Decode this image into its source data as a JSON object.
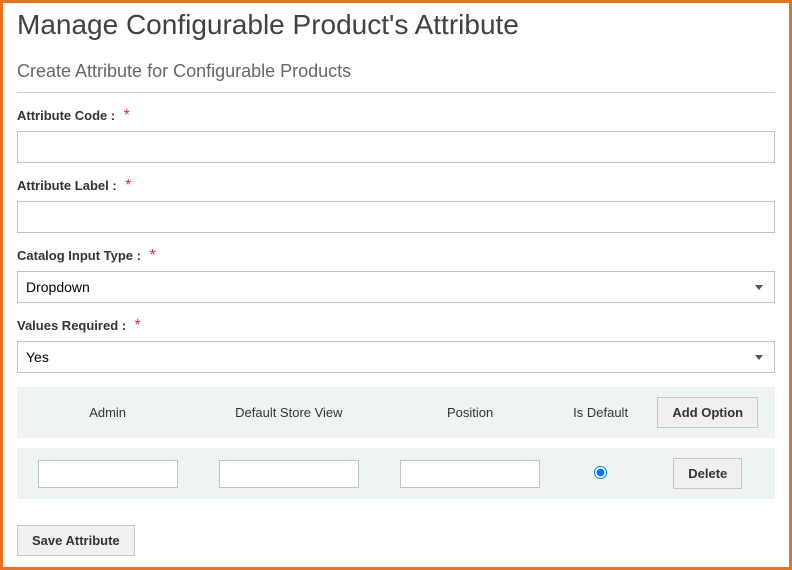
{
  "page_title": "Manage Configurable Product's Attribute",
  "sub_title": "Create Attribute for Configurable Products",
  "required_mark": "*",
  "fields": {
    "attr_code": {
      "label": "Attribute Code :",
      "value": ""
    },
    "attr_label": {
      "label": "Attribute Label :",
      "value": ""
    },
    "input_type": {
      "label": "Catalog Input Type :",
      "selected": "Dropdown"
    },
    "values_required": {
      "label": "Values Required :",
      "selected": "Yes"
    }
  },
  "options": {
    "headers": {
      "admin": "Admin",
      "store_view": "Default Store View",
      "position": "Position",
      "is_default": "Is Default"
    },
    "add_button": "Add Option",
    "delete_button": "Delete",
    "rows": [
      {
        "admin": "",
        "store_view": "",
        "position": "",
        "is_default": true
      }
    ]
  },
  "save_button": "Save Attribute"
}
